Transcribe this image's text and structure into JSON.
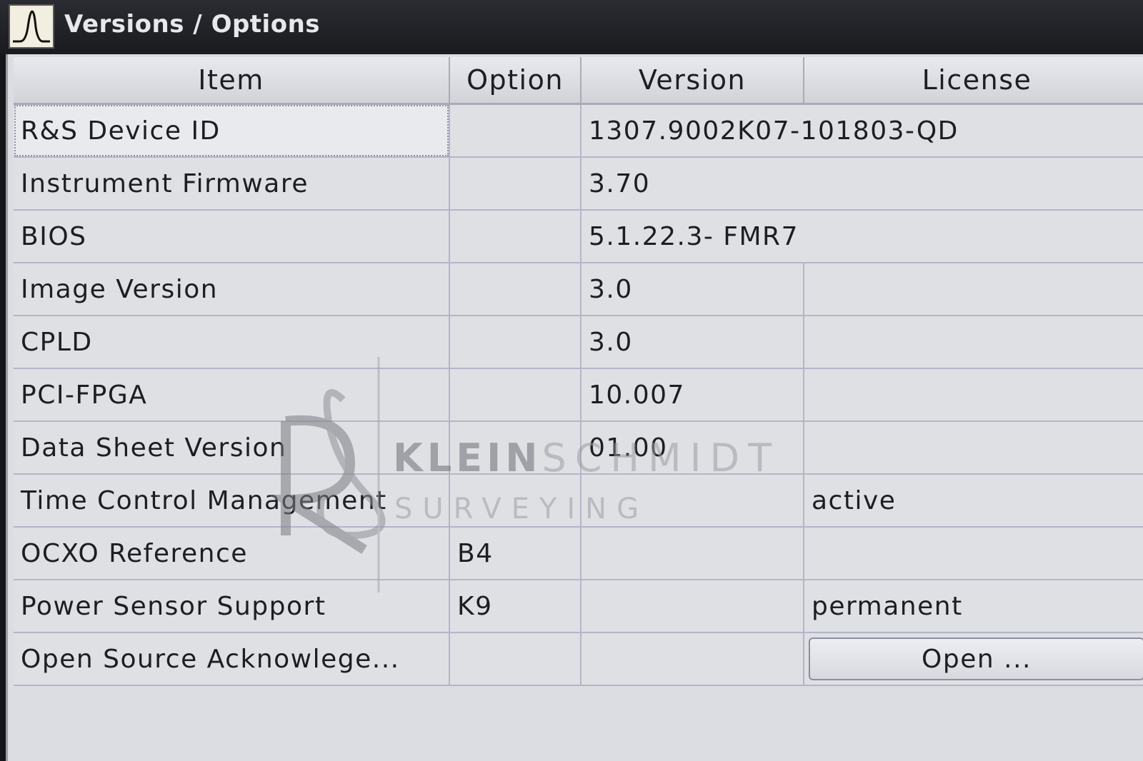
{
  "window": {
    "title": "Versions / Options",
    "icon": "spectrum-analyzer-icon"
  },
  "table": {
    "columns": [
      "Item",
      "Option",
      "Version",
      "License"
    ],
    "rows": [
      {
        "item": "R&S Device ID",
        "option": "",
        "version": "1307.9002K07-101803-QD",
        "license": ""
      },
      {
        "item": "Instrument Firmware",
        "option": "",
        "version": "3.70",
        "license": ""
      },
      {
        "item": "BIOS",
        "option": "",
        "version": "5.1.22.3- FMR7",
        "license": ""
      },
      {
        "item": "Image Version",
        "option": "",
        "version": "3.0",
        "license": ""
      },
      {
        "item": "CPLD",
        "option": "",
        "version": "3.0",
        "license": ""
      },
      {
        "item": "PCI-FPGA",
        "option": "",
        "version": "10.007",
        "license": ""
      },
      {
        "item": "Data Sheet Version",
        "option": "",
        "version": "01.00",
        "license": ""
      },
      {
        "item": "Time Control Management",
        "option": "",
        "version": "",
        "license": "active"
      },
      {
        "item": "OCXO Reference",
        "option": "B4",
        "version": "",
        "license": ""
      },
      {
        "item": "Power Sensor Support",
        "option": "K9",
        "version": "",
        "license": "permanent"
      },
      {
        "item": "Open Source Acknowlege...",
        "option": "",
        "version": "",
        "license": "",
        "button": "Open ..."
      }
    ]
  },
  "watermark": {
    "brand_bold": "KLEIN",
    "brand_light": "SCHMIDT",
    "sub": "SURVEYING"
  }
}
